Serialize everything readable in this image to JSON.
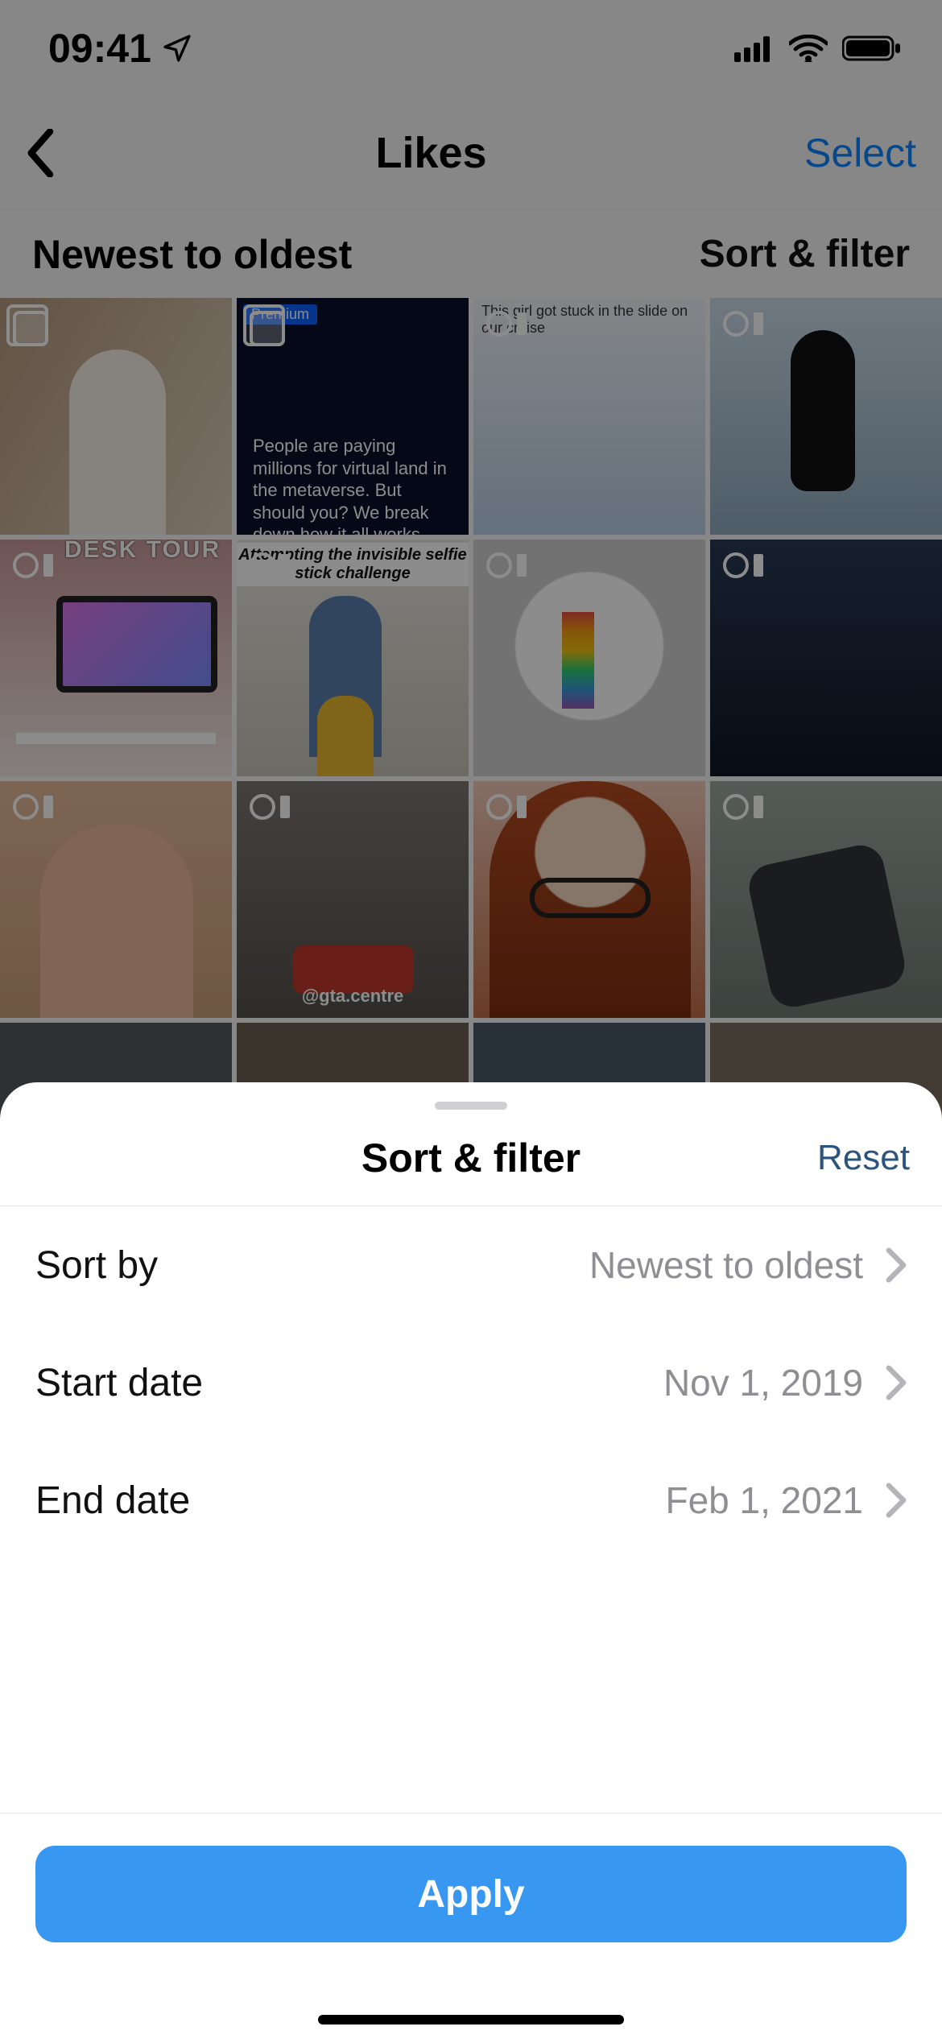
{
  "status_bar": {
    "time": "09:41"
  },
  "nav": {
    "title": "Likes",
    "select": "Select"
  },
  "subheader": {
    "order_label": "Newest to oldest",
    "filter_label": "Sort & filter"
  },
  "tiles": {
    "premium_label": "Premium",
    "metaverse_caption": "People are paying millions for virtual land in the metaverse. But should you? We break down how it all works and why it could be a risky bet.",
    "slide_caption": "This girl got stuck in the slide on our cruise",
    "desk_tour": "DESK TOUR",
    "selfie_challenge": "Attempting the invisible selfie stick challenge",
    "gta_handle": "@gta.centre"
  },
  "sheet": {
    "title": "Sort & filter",
    "reset": "Reset",
    "rows": {
      "sort_by": {
        "label": "Sort by",
        "value": "Newest to oldest"
      },
      "start_date": {
        "label": "Start date",
        "value": "Nov 1, 2019"
      },
      "end_date": {
        "label": "End date",
        "value": "Feb 1, 2021"
      }
    },
    "apply": "Apply"
  }
}
